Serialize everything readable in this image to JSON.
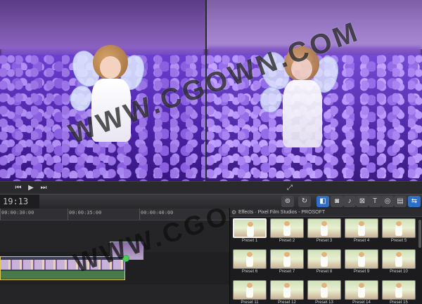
{
  "watermark": {
    "text": "WWW.CGOWN.COM"
  },
  "transport": {
    "prev_icon": "⏮",
    "play_icon": "▶",
    "next_icon": "⏭",
    "fullscreen_icon": "⤢"
  },
  "toolbar": {
    "timecode": "19:13",
    "tools": [
      {
        "icon": "audio-knob-icon",
        "glyph": "⊚"
      },
      {
        "icon": "retime-icon",
        "glyph": "↻"
      },
      {
        "icon": "effects-browser-icon",
        "glyph": "◧"
      },
      {
        "icon": "photo-icon",
        "glyph": "◙"
      },
      {
        "icon": "music-icon",
        "glyph": "♪"
      },
      {
        "icon": "transitions-icon",
        "glyph": "⊠"
      },
      {
        "icon": "titles-icon",
        "glyph": "T"
      },
      {
        "icon": "generators-icon",
        "glyph": "◎"
      },
      {
        "icon": "themes-icon",
        "glyph": "▤"
      },
      {
        "icon": "view-options-icon",
        "glyph": "⇆"
      }
    ]
  },
  "timeline": {
    "ruler_labels": [
      "00:00:30:00",
      "00:00:35:00",
      "00:00:40:00"
    ]
  },
  "effects": {
    "header": "Effects · Pixel Film Studios - PROSOFT",
    "presets": [
      "Preset 1",
      "Preset 2",
      "Preset 3",
      "Preset 4",
      "Preset 5",
      "Preset 6",
      "Preset 7",
      "Preset 8",
      "Preset 9",
      "Preset 10",
      "Preset 11",
      "Preset 12",
      "Preset 13",
      "Preset 14",
      "Preset 15"
    ]
  },
  "colors": {
    "accent": "#2f6fc7",
    "clip_border": "#e2c95b",
    "background": "#1b1b1e"
  }
}
